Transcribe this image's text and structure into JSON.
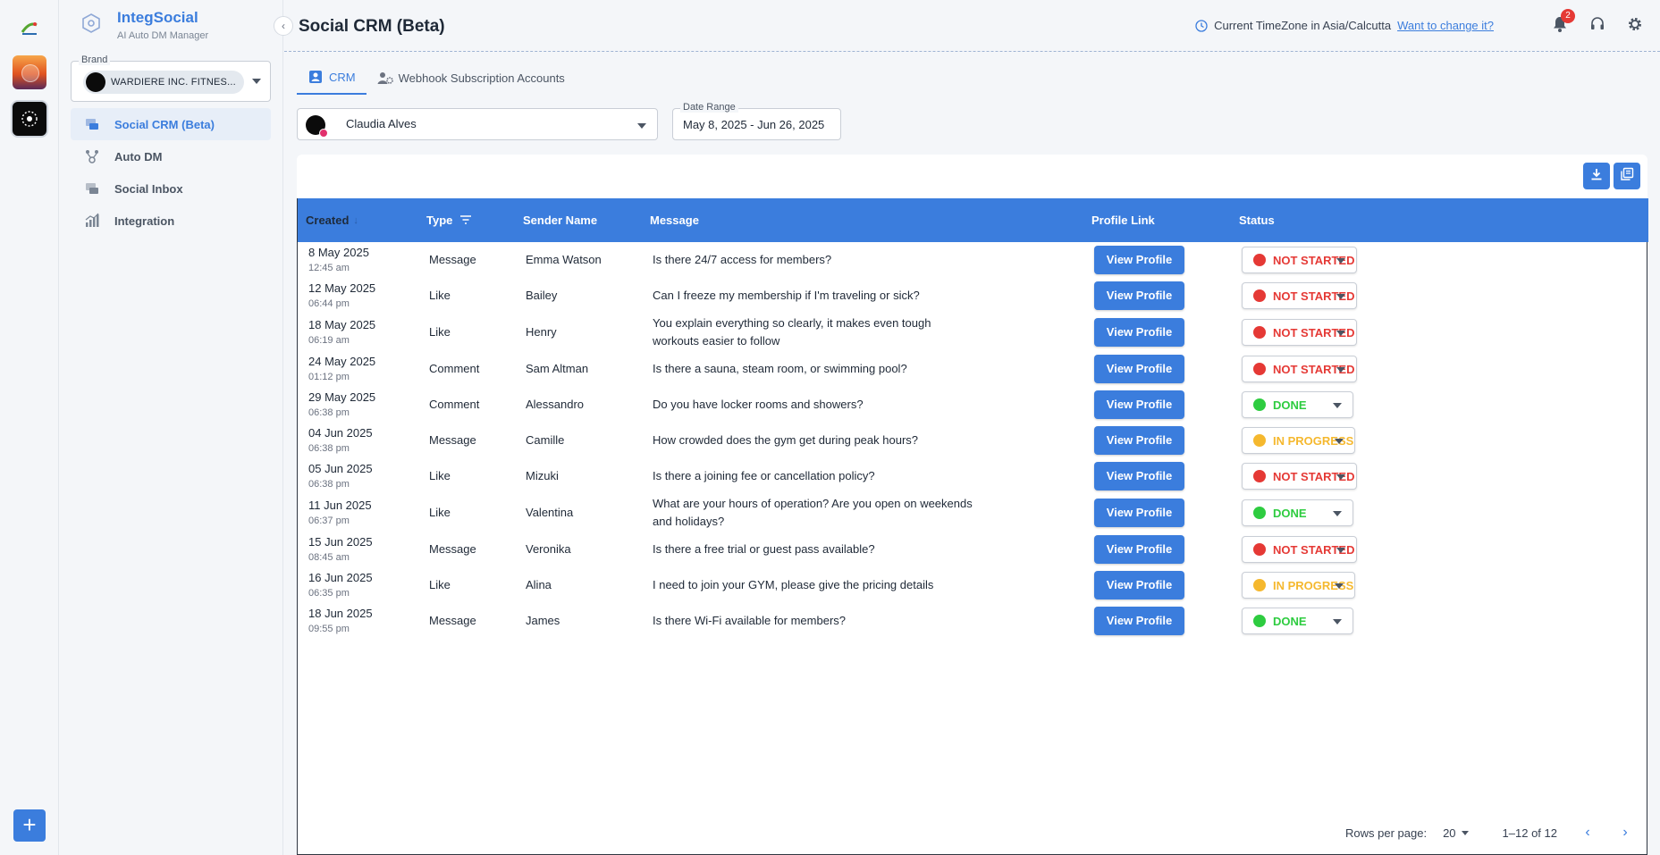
{
  "app": {
    "name": "IntegSocial",
    "subtitle": "AI Auto DM Manager"
  },
  "brand": {
    "label": "Brand",
    "selected": "WARDIERE INC. FITNES..."
  },
  "sidebar": {
    "items": [
      {
        "label": "Social CRM (Beta)",
        "icon": "crm-icon",
        "active": true
      },
      {
        "label": "Auto DM",
        "icon": "auto-dm-icon",
        "active": false
      },
      {
        "label": "Social Inbox",
        "icon": "inbox-icon",
        "active": false
      },
      {
        "label": "Integration",
        "icon": "integration-chart-icon",
        "active": false
      }
    ]
  },
  "header": {
    "title": "Social CRM (Beta)",
    "timezone_text": "Current TimeZone in Asia/Calcutta",
    "timezone_link": "Want to change it?",
    "notification_count": "2"
  },
  "tabs": [
    {
      "label": "CRM",
      "active": true
    },
    {
      "label": "Webhook Subscription Accounts",
      "active": false
    }
  ],
  "filters": {
    "account": "Claudia Alves",
    "date_range_label": "Date Range",
    "date_range_value": "May 8, 2025 - Jun 26, 2025"
  },
  "table": {
    "columns": [
      "Created",
      "Type",
      "Sender Name",
      "Message",
      "Profile Link",
      "Status"
    ],
    "view_profile_label": "View Profile",
    "rows": [
      {
        "date": "8 May 2025",
        "time": "12:45 am",
        "type": "Message",
        "sender": "Emma Watson",
        "message": "Is there 24/7 access for members?",
        "status": "NOT STARTED"
      },
      {
        "date": "12 May 2025",
        "time": "06:44 pm",
        "type": "Like",
        "sender": "Bailey",
        "message": "Can I freeze my membership if I'm traveling or sick?",
        "status": "NOT STARTED"
      },
      {
        "date": "18 May 2025",
        "time": "06:19 am",
        "type": "Like",
        "sender": "Henry",
        "message": "You explain everything so clearly, it makes even tough workouts easier to follow",
        "status": "NOT STARTED"
      },
      {
        "date": "24 May 2025",
        "time": "01:12 pm",
        "type": "Comment",
        "sender": "Sam Altman",
        "message": "Is there a sauna, steam room, or swimming pool?",
        "status": "NOT STARTED"
      },
      {
        "date": "29 May 2025",
        "time": "06:38 pm",
        "type": "Comment",
        "sender": "Alessandro",
        "message": "Do you have locker rooms and showers?",
        "status": "DONE"
      },
      {
        "date": "04 Jun 2025",
        "time": "06:38 pm",
        "type": "Message",
        "sender": "Camille",
        "message": "How crowded does the gym get during peak hours?",
        "status": "IN PROGRESS"
      },
      {
        "date": "05 Jun 2025",
        "time": "06:38 pm",
        "type": "Like",
        "sender": "Mizuki",
        "message": "Is there a joining fee or cancellation policy?",
        "status": "NOT STARTED"
      },
      {
        "date": "11 Jun 2025",
        "time": "06:37 pm",
        "type": "Like",
        "sender": "Valentina",
        "message": "What are your hours of operation? Are you open on weekends and holidays?",
        "status": "DONE"
      },
      {
        "date": "15 Jun 2025",
        "time": "08:45 am",
        "type": "Message",
        "sender": "Veronika",
        "message": "Is there a free trial or guest pass available?",
        "status": "NOT STARTED"
      },
      {
        "date": "16 Jun 2025",
        "time": "06:35 pm",
        "type": "Like",
        "sender": "Alina",
        "message": "I need to join your GYM, please give the pricing details",
        "status": "IN PROGRESS"
      },
      {
        "date": "18 Jun 2025",
        "time": "09:55 pm",
        "type": "Message",
        "sender": "James",
        "message": "Is there Wi-Fi available for members?",
        "status": "DONE"
      }
    ]
  },
  "status_colors": {
    "NOT STARTED": "#e53935",
    "DONE": "#2ecc40",
    "IN PROGRESS": "#f5b82e"
  },
  "pagination": {
    "rows_per_page_label": "Rows per page:",
    "rows_per_page": "20",
    "range": "1–12 of 12"
  },
  "colors": {
    "accent": "#3b7ddd"
  }
}
